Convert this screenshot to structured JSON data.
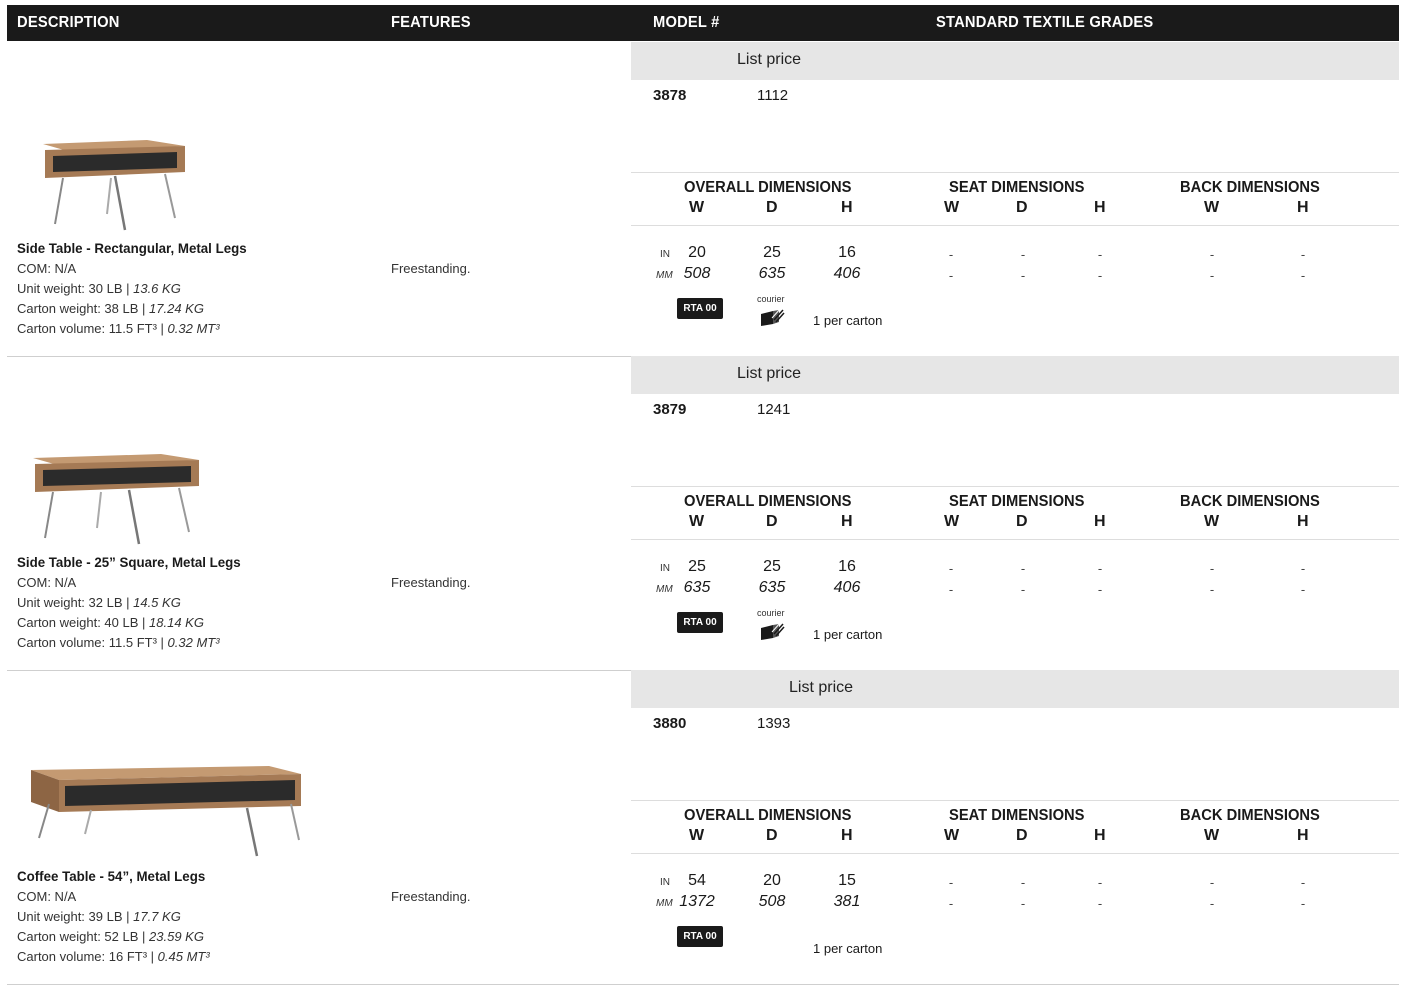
{
  "header": {
    "description": "DESCRIPTION",
    "features": "FEATURES",
    "model": "MODEL #",
    "textile": "STANDARD TEXTILE GRADES"
  },
  "labels": {
    "list_price": "List price",
    "overall": "OVERALL DIMENSIONS",
    "seat": "SEAT DIMENSIONS",
    "back": "BACK DIMENSIONS",
    "w": "W",
    "d": "D",
    "h": "H",
    "in": "IN",
    "mm": "MM",
    "dash": "-",
    "rta": "RTA 00",
    "courier": "courier",
    "per_carton": "1 per carton"
  },
  "products": [
    {
      "title": "Side Table - Rectangular, Metal Legs",
      "com": "COM: N/A",
      "unit_weight": "Unit weight: 30 LB | ",
      "unit_weight_kg": "13.6 KG",
      "carton_weight": "Carton weight: 38 LB | ",
      "carton_weight_kg": "17.24 KG",
      "carton_volume": "Carton volume: 11.5 FT³ | ",
      "carton_volume_m": "0.32 MT³",
      "features": "Freestanding.",
      "model": "3878",
      "price": "1112",
      "in": {
        "w": "20",
        "d": "25",
        "h": "16"
      },
      "mm": {
        "w": "508",
        "d": "635",
        "h": "406"
      },
      "courier": true
    },
    {
      "title": "Side Table - 25” Square, Metal Legs",
      "com": "COM: N/A",
      "unit_weight": "Unit weight: 32 LB | ",
      "unit_weight_kg": "14.5 KG",
      "carton_weight": "Carton weight: 40 LB | ",
      "carton_weight_kg": "18.14 KG",
      "carton_volume": "Carton volume: 11.5 FT³ | ",
      "carton_volume_m": "0.32 MT³",
      "features": "Freestanding.",
      "model": "3879",
      "price": "1241",
      "in": {
        "w": "25",
        "d": "25",
        "h": "16"
      },
      "mm": {
        "w": "635",
        "d": "635",
        "h": "406"
      },
      "courier": true
    },
    {
      "title": "Coffee Table - 54”, Metal Legs",
      "com": "COM: N/A",
      "unit_weight": "Unit weight: 39 LB | ",
      "unit_weight_kg": "17.7 KG",
      "carton_weight": "Carton weight: 52 LB | ",
      "carton_weight_kg": "23.59 KG",
      "carton_volume": "Carton volume: 16 FT³ | ",
      "carton_volume_m": "0.45 MT³",
      "features": "Freestanding.",
      "model": "3880",
      "price": "1393",
      "in": {
        "w": "54",
        "d": "20",
        "h": "15"
      },
      "mm": {
        "w": "1372",
        "d": "508",
        "h": "381"
      },
      "courier": false
    }
  ],
  "colors": {
    "header_bg": "#1a1a1a",
    "list_price_bar": "#e6e6e6",
    "wood": "#a57a55"
  },
  "icons": [
    "courier-box-icon"
  ]
}
